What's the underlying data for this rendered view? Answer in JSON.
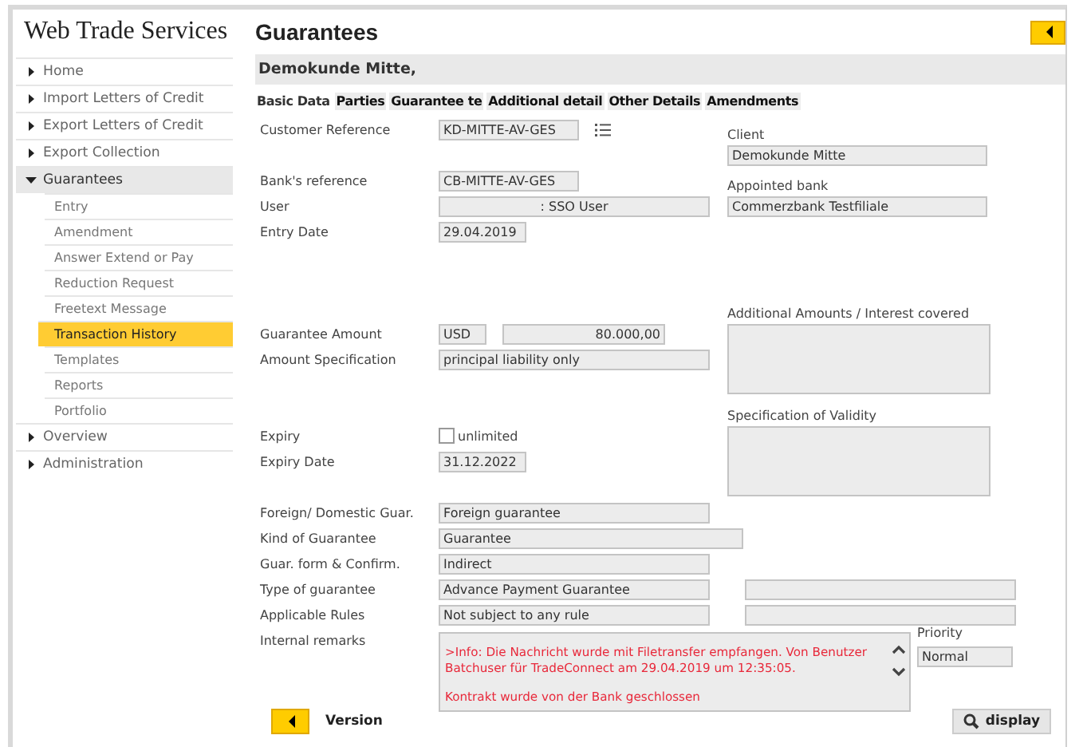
{
  "app_title": "Web Trade Services",
  "sidebar": {
    "items": [
      {
        "label": "Home",
        "expanded": false,
        "selected": false
      },
      {
        "label": "Import Letters of Credit",
        "expanded": false,
        "selected": false
      },
      {
        "label": "Export Letters of Credit",
        "expanded": false,
        "selected": false
      },
      {
        "label": "Export Collection",
        "expanded": false,
        "selected": false
      },
      {
        "label": "Guarantees",
        "expanded": true,
        "selected": false,
        "children": [
          {
            "label": "Entry",
            "selected": false
          },
          {
            "label": "Amendment",
            "selected": false
          },
          {
            "label": "Answer Extend or Pay",
            "selected": false
          },
          {
            "label": "Reduction Request",
            "selected": false
          },
          {
            "label": "Freetext Message",
            "selected": false
          },
          {
            "label": "Transaction History",
            "selected": true
          },
          {
            "label": "Templates",
            "selected": false
          },
          {
            "label": "Reports",
            "selected": false
          },
          {
            "label": "Portfolio",
            "selected": false
          }
        ]
      },
      {
        "label": "Overview",
        "expanded": false,
        "selected": false
      },
      {
        "label": "Administration",
        "expanded": false,
        "selected": false
      }
    ]
  },
  "page_title": "Guarantees",
  "customer_header": "Demokunde Mitte,",
  "tabs": [
    {
      "label": "Basic Data",
      "selected": true
    },
    {
      "label": "Parties",
      "selected": false
    },
    {
      "label": "Guarantee te",
      "selected": false
    },
    {
      "label": "Additional detail",
      "selected": false
    },
    {
      "label": "Other Details",
      "selected": false
    },
    {
      "label": "Amendments",
      "selected": false
    }
  ],
  "fields": [
    {
      "kind": "lookup",
      "label": "Customer Reference",
      "values": [
        "KD-MITTE-AV-GES"
      ]
    },
    {
      "kind": "short",
      "label": "Bank's reference",
      "values": [
        "CB-MITTE-AV-GES"
      ]
    },
    {
      "kind": "centered",
      "label": "User",
      "values": [
        ": SSO User"
      ]
    },
    {
      "kind": "date",
      "label": "Entry Date",
      "values": [
        "29.04.2019"
      ]
    },
    {
      "kind": "amount",
      "label": "Guarantee Amount",
      "values": [
        "USD",
        "80.000,00"
      ]
    },
    {
      "kind": "text",
      "label": "Amount Specification",
      "values": [
        "principal liability only"
      ]
    },
    {
      "kind": "checkbox",
      "label": "Expiry",
      "option": "unlimited",
      "checked": false
    },
    {
      "kind": "date",
      "label": "Expiry Date",
      "values": [
        "31.12.2022"
      ]
    },
    {
      "kind": "text",
      "label": "Foreign/ Domestic Guar.",
      "values": [
        "Foreign guarantee"
      ]
    },
    {
      "kind": "wide",
      "label": "Kind of Guarantee",
      "values": [
        "Guarantee"
      ]
    },
    {
      "kind": "text",
      "label": "Guar. form & Confirm.",
      "values": [
        "Indirect"
      ]
    },
    {
      "kind": "double",
      "label": "Type of guarantee",
      "values": [
        "Advance Payment Guarantee"
      ]
    },
    {
      "kind": "double",
      "label": "Applicable Rules",
      "values": [
        "Not subject to any rule"
      ]
    },
    {
      "kind": "remarks",
      "label": "Internal remarks",
      "paragraphs": [
        ">Info: Die Nachricht wurde mit Filetransfer empfangen. Von Benutzer Batchuser für TradeConnect am 29.04.2019 um 12:35:05.",
        "Kontrakt wurde von der Bank geschlossen"
      ]
    }
  ],
  "right_fields": [
    {
      "kind": "field",
      "label": "Client",
      "value": "Demokunde Mitte"
    },
    {
      "kind": "field",
      "label": "Appointed bank",
      "value": "Commerzbank Testfiliale"
    },
    {
      "kind": "area",
      "label": "Additional Amounts / Interest covered"
    },
    {
      "kind": "area",
      "label": "Specification of Validity"
    }
  ],
  "priority": {
    "label": "Priority",
    "value": "Normal"
  },
  "buttons": {
    "version": "Version",
    "display": "display"
  }
}
